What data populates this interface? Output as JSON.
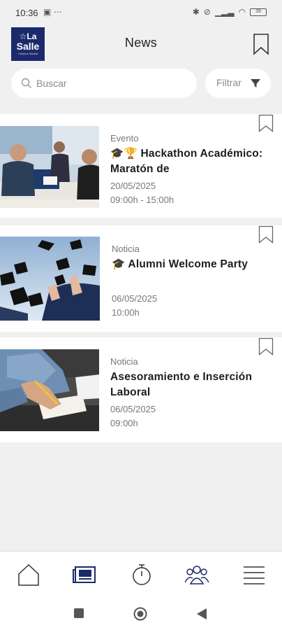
{
  "status_bar": {
    "time": "10:36",
    "extra": "⋯",
    "battery": "39"
  },
  "header": {
    "logo_line1": "☆La",
    "logo_line2": "Salle",
    "logo_line3": "Campus Madrid",
    "title": "News"
  },
  "search": {
    "placeholder": "Buscar",
    "value": ""
  },
  "filter": {
    "label": "Filtrar"
  },
  "news": [
    {
      "category": "Evento",
      "title": "🎓🏆 Hackathon Académico: Maratón de",
      "date": "20/05/2025",
      "time": "09:00h - 15:00h"
    },
    {
      "category": "Noticia",
      "title": "🎓 Alumni Welcome Party",
      "date": "06/05/2025",
      "time": "10:00h"
    },
    {
      "category": "Noticia",
      "title": "Asesoramiento e Inserción Laboral",
      "date": "06/05/2025",
      "time": "09:00h"
    }
  ],
  "bottom_nav": {
    "items": [
      "home-icon",
      "news-icon",
      "stopwatch-icon",
      "community-icon",
      "menu-icon"
    ],
    "active": "news-icon"
  },
  "colors": {
    "brand": "#1b2a6b",
    "background": "#f0f0f0",
    "card": "#ffffff",
    "muted": "#777777"
  }
}
